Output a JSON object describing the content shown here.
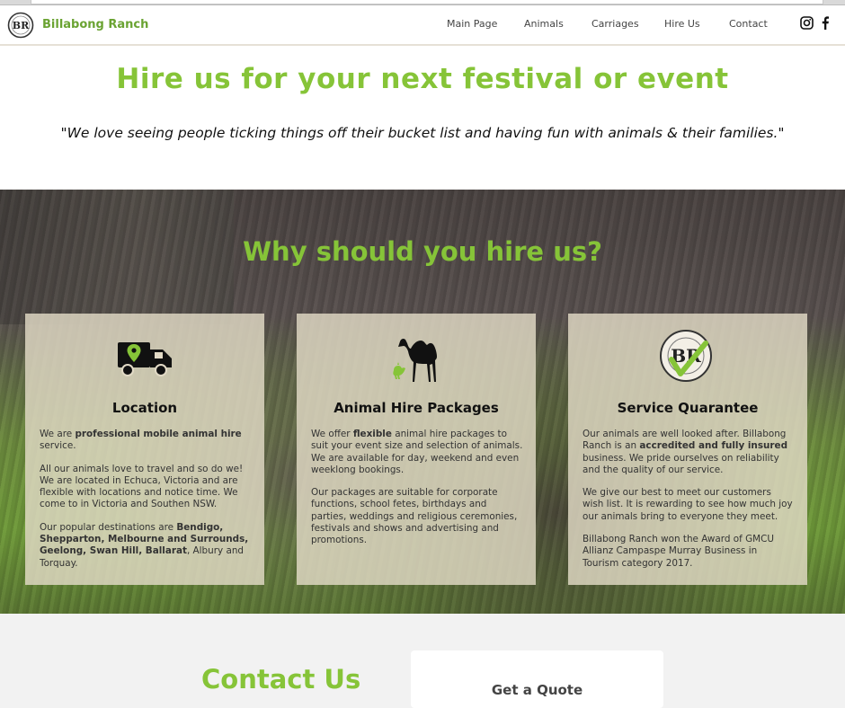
{
  "header": {
    "brand": "Billabong Ranch",
    "logo_text": "BR",
    "nav": [
      "Main Page",
      "Animals",
      "Carriages",
      "Hire Us",
      "Contact"
    ],
    "social": [
      "instagram-icon",
      "facebook-icon"
    ]
  },
  "hero": {
    "title": "Hire us for your next festival or event",
    "quote": "\"We love seeing people ticking things off their bucket list and having fun with animals & their families.\""
  },
  "why": {
    "title": "Why should you hire us?",
    "cards": [
      {
        "icon": "truck-location-icon",
        "title": "Location",
        "p1a": "We are ",
        "p1b": "professional mobile animal hire",
        "p1c": " service.",
        "p2": "All our animals love to travel and so do we! We are located in Echuca, Victoria and are flexible with locations and notice time. We come to in Victoria and Southen NSW.",
        "p3a": "Our popular destinations are ",
        "p3b": "Bendigo, Shepparton, Melbourne and Surrounds, Geelong, Swan Hill, Ballarat",
        "p3c": ", Albury and Torquay."
      },
      {
        "icon": "camel-chicken-icon",
        "title": "Animal Hire Packages",
        "p1a": "We offer ",
        "p1b": "flexible",
        "p1c": " animal hire packages to suit your event size and selection of animals. We are available for day, weekend and even weeklong bookings.",
        "p2": "Our packages are suitable for corporate functions, school fetes, birthdays and parties, weddings and religious ceremonies, festivals and shows and advertising and promotions."
      },
      {
        "icon": "br-badge-check-icon",
        "badge_text": "BR",
        "title": "Service Quarantee",
        "p1a": "Our animals are well looked after. Billabong Ranch is an ",
        "p1b": "accredited and fully insured",
        "p1c": " business. We pride ourselves on reliability and the quality of our service.",
        "p2": "We give our best to meet our customers wish list. It is rewarding to see how much joy our animals bring to everyone they meet.",
        "p3": "Billabong Ranch won the Award of GMCU Allianz Campaspe Murray Business in Tourism category 2017."
      }
    ]
  },
  "contact": {
    "title": "Contact Us",
    "quote_card_title": "Get a Quote"
  },
  "colors": {
    "accent_green": "#86c438",
    "brand_green": "#6aa332",
    "card_bg": "#e2dac6"
  }
}
